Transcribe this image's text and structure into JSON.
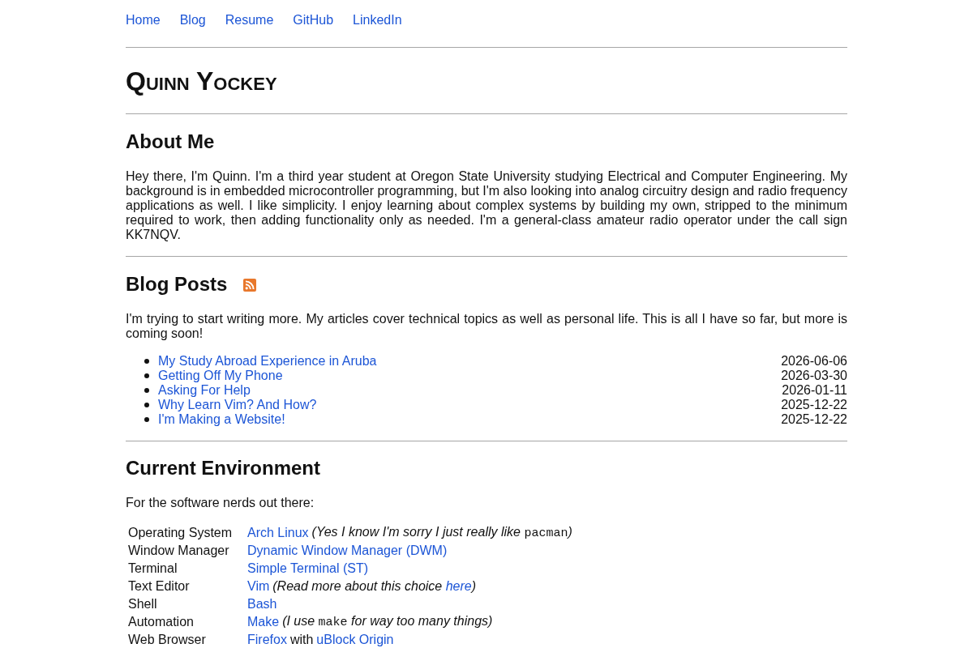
{
  "nav": [
    "Home",
    "Blog",
    "Resume",
    "GitHub",
    "LinkedIn"
  ],
  "title": "Quinn Yockey",
  "about": {
    "heading": "About Me",
    "text": "Hey there, I'm Quinn. I'm a third year student at Oregon State University studying Electrical and Computer Engineering. My background is in embedded microcontroller programming, but I'm also looking into analog circuitry design and radio frequency applications as well. I like simplicity. I enjoy learning about complex systems by building my own, stripped to the minimum required to work, then adding functionality only as needed. I'm a general-class amateur radio operator under the call sign KK7NQV."
  },
  "blog": {
    "heading": "Blog Posts",
    "intro": "I'm trying to start writing more. My articles cover technical topics as well as personal life. This is all I have so far, but more is coming soon!",
    "posts": [
      {
        "title": "My Study Abroad Experience in Aruba",
        "date": "2026-06-06"
      },
      {
        "title": "Getting Off My Phone",
        "date": "2026-03-30"
      },
      {
        "title": "Asking For Help",
        "date": "2026-01-11"
      },
      {
        "title": "Why Learn Vim? And How?",
        "date": "2025-12-22"
      },
      {
        "title": "I'm Making a Website!",
        "date": "2025-12-22"
      }
    ]
  },
  "environment": {
    "heading": "Current Environment",
    "intro": "For the software nerds out there:",
    "rows": [
      {
        "label": "Operating System",
        "value": [
          {
            "kind": "link",
            "text": "Arch Linux"
          },
          {
            "kind": "note",
            "parts": [
              {
                "kind": "text",
                "text": "(Yes I know I'm sorry I just really like "
              },
              {
                "kind": "code",
                "text": "pacman"
              },
              {
                "kind": "text",
                "text": ")"
              }
            ]
          }
        ]
      },
      {
        "label": "Window Manager",
        "value": [
          {
            "kind": "link",
            "text": "Dynamic Window Manager (DWM)"
          }
        ]
      },
      {
        "label": "Terminal",
        "value": [
          {
            "kind": "link",
            "text": "Simple Terminal (ST)"
          }
        ]
      },
      {
        "label": "Text Editor",
        "value": [
          {
            "kind": "link",
            "text": "Vim"
          },
          {
            "kind": "note",
            "parts": [
              {
                "kind": "text",
                "text": "(Read more about this choice "
              },
              {
                "kind": "link",
                "text": "here"
              },
              {
                "kind": "text",
                "text": ")"
              }
            ]
          }
        ]
      },
      {
        "label": "Shell",
        "value": [
          {
            "kind": "link",
            "text": "Bash"
          }
        ]
      },
      {
        "label": "Automation",
        "value": [
          {
            "kind": "link",
            "text": "Make"
          },
          {
            "kind": "note",
            "parts": [
              {
                "kind": "text",
                "text": "(I use "
              },
              {
                "kind": "code",
                "text": "make"
              },
              {
                "kind": "text",
                "text": " for way too many things)"
              }
            ]
          }
        ]
      },
      {
        "label": "Web Browser",
        "value": [
          {
            "kind": "link",
            "text": "Firefox"
          },
          {
            "kind": "text",
            "text": "with"
          },
          {
            "kind": "link",
            "text": "uBlock Origin"
          }
        ]
      }
    ]
  }
}
